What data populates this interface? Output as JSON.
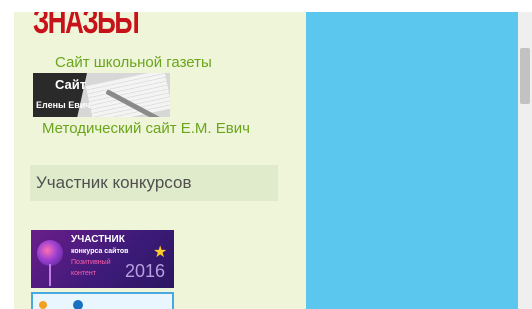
{
  "sidebar": {
    "logo_text": "ЗНАЗБЫ",
    "link_school_newspaper": "Сайт школьной газеты",
    "banner_evich": {
      "line1": "Сайт",
      "line2": "Елены Евич"
    },
    "link_methodical_site": "Методический сайт Е.М. Евич",
    "section_title": "Участник конкурсов",
    "badge_2016": {
      "title": "УЧАСТНИК",
      "subtitle": "конкурса сайтов",
      "line1": "Позитивный",
      "line2": "контент",
      "year": "2016"
    }
  },
  "colors": {
    "sidebar_bg": "#eef5d8",
    "link_green": "#6aa51c",
    "content_blue": "#5bc7ee",
    "section_header_bg": "#e0ebcb"
  }
}
